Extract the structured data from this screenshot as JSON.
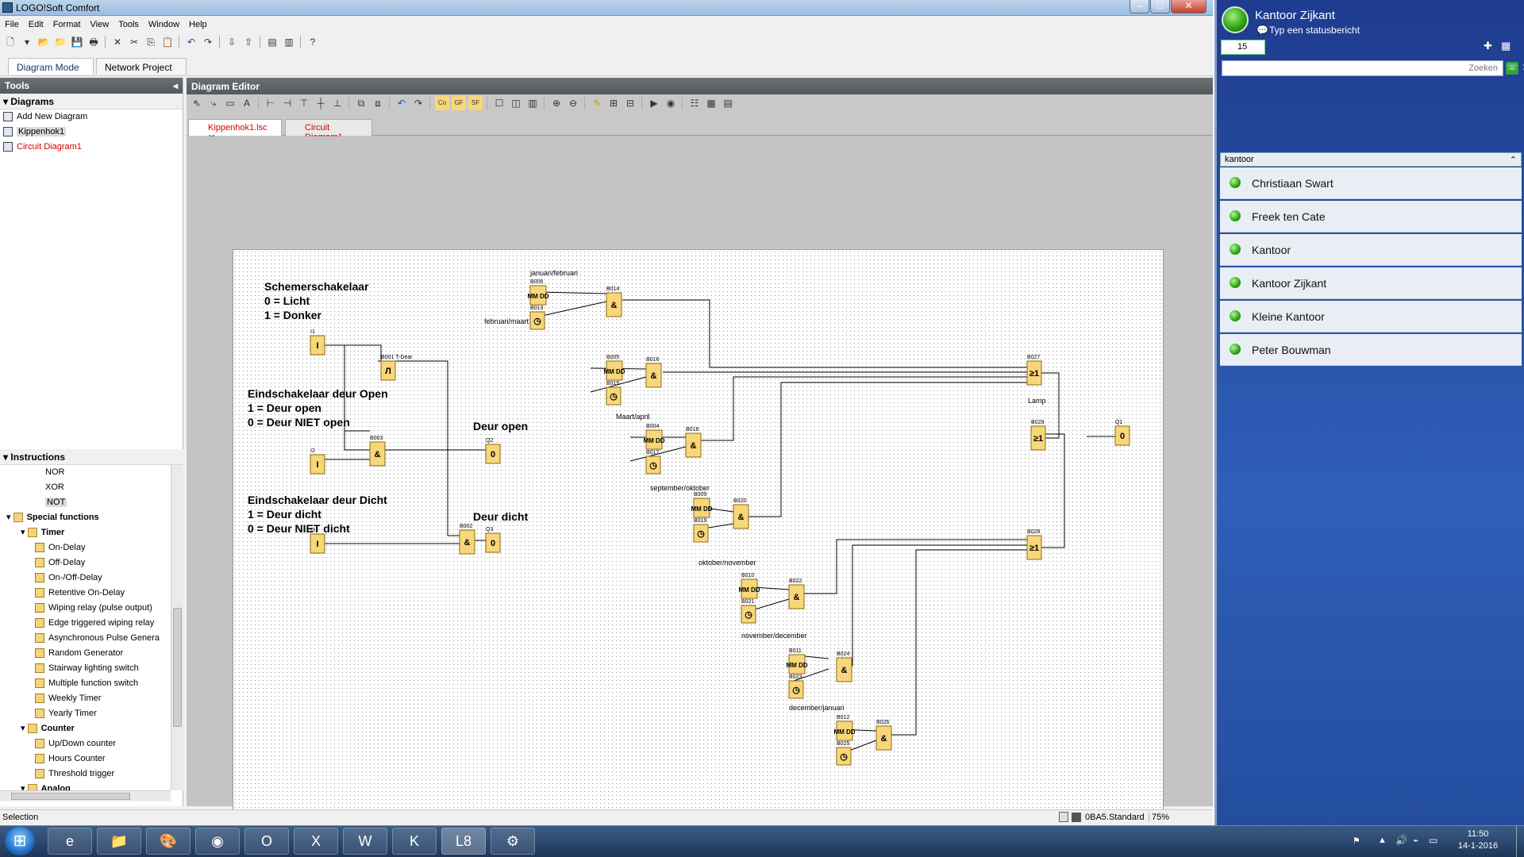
{
  "app": {
    "title": "LOGO!Soft Comfort",
    "menu": [
      "File",
      "Edit",
      "Format",
      "View",
      "Tools",
      "Window",
      "Help"
    ],
    "mode_tabs": [
      "Diagram Mode",
      "Network Project"
    ],
    "tools_panel": {
      "title": "Tools",
      "diagrams_header": "Diagrams",
      "diagram_items": [
        {
          "label": "Add New Diagram"
        },
        {
          "label": "Kippenhok1"
        },
        {
          "label": "Circuit Diagram1"
        }
      ],
      "instructions_header": "Instructions",
      "instructions": [
        {
          "label": "NOR",
          "level": 2,
          "icon": "gate"
        },
        {
          "label": "XOR",
          "level": 2,
          "icon": "gate"
        },
        {
          "label": "NOT",
          "level": 2,
          "icon": "gate"
        },
        {
          "label": "Special functions",
          "level": 0,
          "icon": "folder",
          "bold": true
        },
        {
          "label": "Timer",
          "level": 1,
          "icon": "folder",
          "bold": true
        },
        {
          "label": "On-Delay",
          "level": 2,
          "icon": "block"
        },
        {
          "label": "Off-Delay",
          "level": 2,
          "icon": "block"
        },
        {
          "label": "On-/Off-Delay",
          "level": 2,
          "icon": "block"
        },
        {
          "label": "Retentive On-Delay",
          "level": 2,
          "icon": "block"
        },
        {
          "label": "Wiping relay (pulse output)",
          "level": 2,
          "icon": "block"
        },
        {
          "label": "Edge triggered wiping relay",
          "level": 2,
          "icon": "block"
        },
        {
          "label": "Asynchronous Pulse Genera",
          "level": 2,
          "icon": "block"
        },
        {
          "label": "Random Generator",
          "level": 2,
          "icon": "block"
        },
        {
          "label": "Stairway lighting switch",
          "level": 2,
          "icon": "block"
        },
        {
          "label": "Multiple function switch",
          "level": 2,
          "icon": "block"
        },
        {
          "label": "Weekly Timer",
          "level": 2,
          "icon": "block"
        },
        {
          "label": "Yearly Timer",
          "level": 2,
          "icon": "block"
        },
        {
          "label": "Counter",
          "level": 1,
          "icon": "folder",
          "bold": true
        },
        {
          "label": "Up/Down counter",
          "level": 2,
          "icon": "block"
        },
        {
          "label": "Hours Counter",
          "level": 2,
          "icon": "block"
        },
        {
          "label": "Threshold trigger",
          "level": 2,
          "icon": "block"
        },
        {
          "label": "Analog",
          "level": 1,
          "icon": "folder",
          "bold": true
        }
      ]
    },
    "editor": {
      "title": "Diagram Editor",
      "tabs": [
        {
          "label": "Kippenhok1.lsc",
          "active": true
        },
        {
          "label": "Circuit Diagram1",
          "active": false
        }
      ],
      "notes": {
        "schemer_title": "Schemerschakelaar",
        "schemer_l1": "0 = Licht",
        "schemer_l2": "1 = Donker",
        "open_title": "Eindschakelaar deur Open",
        "open_l1": "1 = Deur open",
        "open_l2": "0 = Deur NIET open",
        "dicht_title": "Eindschakelaar deur Dicht",
        "dicht_l1": "1 = Deur dicht",
        "dicht_l2": "0 = Deur NIET dicht",
        "deur_open": "Deur open",
        "deur_dicht": "Deur dicht",
        "lamp": "Lamp",
        "jan_feb": "januari/februari",
        "feb_maart": "februari/maart",
        "maart_april": "Maart/april",
        "sep_okt": "september/oktober",
        "okt_nov": "oktober/november",
        "nov_dec": "november/december",
        "dec_jan": "december/januari"
      },
      "blocks": {
        "I1": "I1",
        "I2": "I2",
        "I3": "I3",
        "B001": "B001 T-Dear",
        "B003": "B003",
        "B002": "B002",
        "Q2": "Q2",
        "Q3": "Q3",
        "Q1": "Q1",
        "B006": "B006",
        "B013": "B013",
        "B014": "B014",
        "B005": "B005",
        "B015": "B015",
        "B016": "B016",
        "B004": "B004",
        "B017": "B017",
        "B018": "B018",
        "B009": "B009",
        "B019": "B019",
        "B020": "B020",
        "B010": "B010",
        "B021": "B021",
        "B022": "B022",
        "B011": "B011",
        "B023": "B023",
        "B024": "B024",
        "B012": "B012",
        "B025": "B025",
        "B026": "B026",
        "B027": "B027",
        "B028": "B028",
        "B029": "B029"
      },
      "glyphs": {
        "input": "I",
        "output": "0",
        "and": "&",
        "or": "≥1",
        "date": "MM DD",
        "clock": "◷",
        "timer": "Л"
      }
    },
    "status": {
      "left": "Selection",
      "device": "0BA5.Standard",
      "zoom": "75%"
    }
  },
  "messenger": {
    "name": "Kantoor Zijkant",
    "status_placeholder": "Typ een statusbericht",
    "message_count": "15",
    "search_placeholder": "Zoeken",
    "group": "kantoor",
    "contacts": [
      "Christiaan Swart",
      "Freek ten Cate",
      "Kantoor",
      "Kantoor Zijkant",
      "Kleine Kantoor",
      "Peter Bouwman"
    ]
  },
  "taskbar": {
    "time": "11:50",
    "date": "14-1-2016",
    "apps": [
      "start",
      "internet-explorer",
      "file-explorer",
      "paint",
      "chrome",
      "outlook",
      "excel",
      "word",
      "k-app",
      "logo-v8",
      "tools"
    ]
  },
  "colors": {
    "block_fill": "#f8d77a",
    "block_border": "#8a6a10",
    "accent_green": "#29a313",
    "editor_header": "#5e6267"
  }
}
